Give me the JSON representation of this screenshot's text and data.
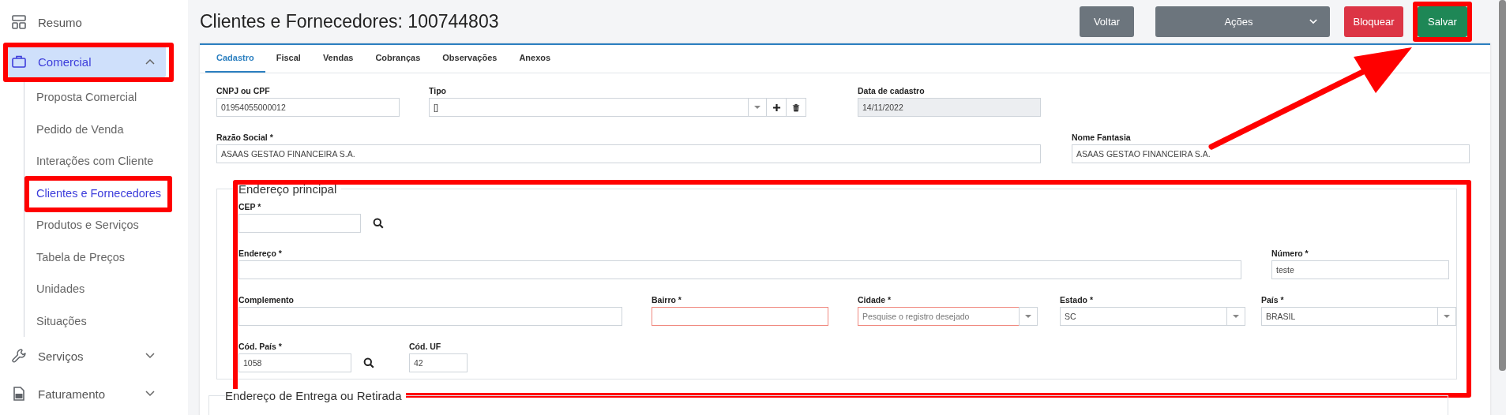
{
  "sidebar": {
    "items": [
      {
        "label": "Resumo",
        "selected": false,
        "highlighted": false
      },
      {
        "label": "Comercial",
        "selected": true,
        "highlighted": true,
        "expanded": true,
        "children": [
          {
            "label": "Proposta Comercial",
            "selected": false,
            "highlighted": false
          },
          {
            "label": "Pedido de Venda",
            "selected": false,
            "highlighted": false
          },
          {
            "label": "Interações com Cliente",
            "selected": false,
            "highlighted": false
          },
          {
            "label": "Clientes e Fornecedores",
            "selected": true,
            "highlighted": true
          },
          {
            "label": "Produtos e Serviços",
            "selected": false,
            "highlighted": false
          },
          {
            "label": "Tabela de Preços",
            "selected": false,
            "highlighted": false
          },
          {
            "label": "Unidades",
            "selected": false,
            "highlighted": false
          },
          {
            "label": "Situações",
            "selected": false,
            "highlighted": false
          }
        ]
      },
      {
        "label": "Serviços",
        "selected": false,
        "highlighted": false,
        "expanded": false
      },
      {
        "label": "Faturamento",
        "selected": false,
        "highlighted": false,
        "expanded": false
      }
    ]
  },
  "page": {
    "title": "Clientes e Fornecedores: 100744803"
  },
  "buttons": [
    {
      "label": "Voltar",
      "kind": "secondary",
      "highlighted": false
    },
    {
      "label": "Ações",
      "kind": "dropdown",
      "highlighted": false
    },
    {
      "label": "Bloquear",
      "kind": "danger",
      "highlighted": false
    },
    {
      "label": "Salvar",
      "kind": "primary",
      "highlighted": true
    }
  ],
  "annotation_arrow": true,
  "tabs": [
    {
      "label": "Cadastro",
      "selected": true
    },
    {
      "label": "Fiscal",
      "selected": false
    },
    {
      "label": "Vendas",
      "selected": false
    },
    {
      "label": "Cobranças",
      "selected": false
    },
    {
      "label": "Observações",
      "selected": false
    },
    {
      "label": "Anexos",
      "selected": false
    }
  ],
  "form_fields": [
    {
      "label": "CNPJ ou CPF",
      "kind": "text",
      "value": "01954055000012",
      "invalid": false,
      "disabled": false
    },
    {
      "label": "Tipo",
      "kind": "select_actions",
      "value": "[]",
      "invalid": false,
      "disabled": false
    },
    {
      "label": "Data de cadastro",
      "kind": "text",
      "value": "14/11/2022",
      "invalid": false,
      "disabled": true
    },
    {
      "label": "Razão Social *",
      "kind": "text",
      "value": "ASAAS GESTAO FINANCEIRA S.A.",
      "invalid": false,
      "disabled": false
    },
    {
      "label": "Nome Fantasia",
      "kind": "text",
      "value": "ASAAS GESTAO FINANCEIRA S.A.",
      "invalid": false,
      "disabled": false
    }
  ],
  "sections": [
    {
      "title": "Endereço principal",
      "highlighted": true,
      "fields": [
        {
          "label": "CEP *",
          "kind": "lookup",
          "invalid": false,
          "disabled": false
        },
        {
          "label": "Endereço *",
          "kind": "text",
          "invalid": false,
          "disabled": false
        },
        {
          "label": "Número *",
          "kind": "text",
          "value": "teste",
          "invalid": false,
          "disabled": false
        },
        {
          "label": "Complemento",
          "kind": "text",
          "invalid": false,
          "disabled": false
        },
        {
          "label": "Bairro *",
          "kind": "text",
          "invalid": true,
          "disabled": false
        },
        {
          "label": "Cidade *",
          "kind": "select",
          "placeholder": "Pesquise o registro desejado",
          "invalid": true,
          "disabled": false
        },
        {
          "label": "Estado *",
          "kind": "select",
          "value": "SC",
          "invalid": false,
          "disabled": false
        },
        {
          "label": "País *",
          "kind": "select",
          "value": "BRASIL",
          "invalid": false,
          "disabled": false
        },
        {
          "label": "Cód. País *",
          "kind": "lookup",
          "value": "1058",
          "invalid": false,
          "disabled": false
        },
        {
          "label": "Cód. UF",
          "kind": "text",
          "value": "42",
          "invalid": false,
          "disabled": false
        }
      ]
    },
    {
      "title": "Endereço de Entrega ou Retirada",
      "highlighted": false
    }
  ]
}
